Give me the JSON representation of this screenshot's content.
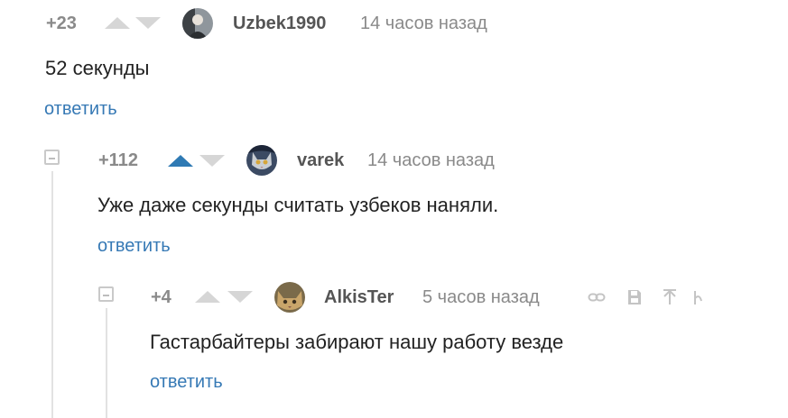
{
  "comments": [
    {
      "score": "+23",
      "author": "Uzbek1990",
      "time": "14 часов назад",
      "text": "52 секунды",
      "reply_label": "ответить",
      "avatar_icon": "user-photo-avatar"
    },
    {
      "score": "+112",
      "author": "varek",
      "time": "14 часов назад",
      "text": "Уже даже секунды считать узбеков наняли.",
      "reply_label": "ответить",
      "upvoted": true,
      "avatar_icon": "cat-avatar"
    },
    {
      "score": "+4",
      "author": "AlkisTer",
      "time": "5 часов назад",
      "text": "Гастарбайтеры забирают нашу работу везде",
      "reply_label": "ответить",
      "avatar_icon": "cat-avatar",
      "tools": [
        "link-icon",
        "save-icon",
        "arrow-up-icon",
        "more-icon"
      ]
    }
  ],
  "colors": {
    "accent": "#2f7ab4",
    "link": "#3679b5",
    "muted": "#8a8a8a",
    "vote_inactive": "#d6d6d6",
    "thread_line": "#e2e2e2"
  }
}
